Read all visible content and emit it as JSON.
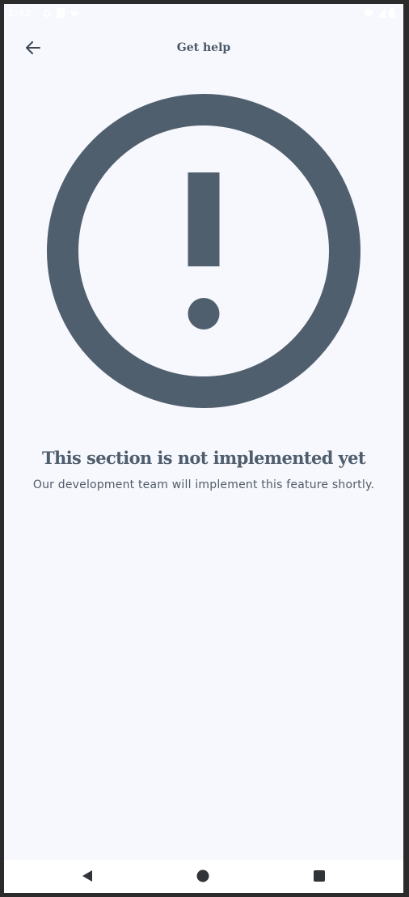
{
  "status_bar": {
    "time": "1:42",
    "left_icons": [
      "settings-icon",
      "sim-icon",
      "notification-icon"
    ],
    "right_icons": [
      "wifi-icon",
      "signal-icon",
      "battery-icon"
    ]
  },
  "app_bar": {
    "back_icon": "arrow-left-icon",
    "title": "Get help"
  },
  "illustration": {
    "icon": "exclamation-circle-icon",
    "color": "#505f6e"
  },
  "message": {
    "headline": "This section is not implemented yet",
    "body": "Our development team will implement this feature shortly."
  },
  "nav_bar": {
    "buttons": [
      "back-triangle-icon",
      "home-circle-icon",
      "recents-square-icon"
    ]
  }
}
